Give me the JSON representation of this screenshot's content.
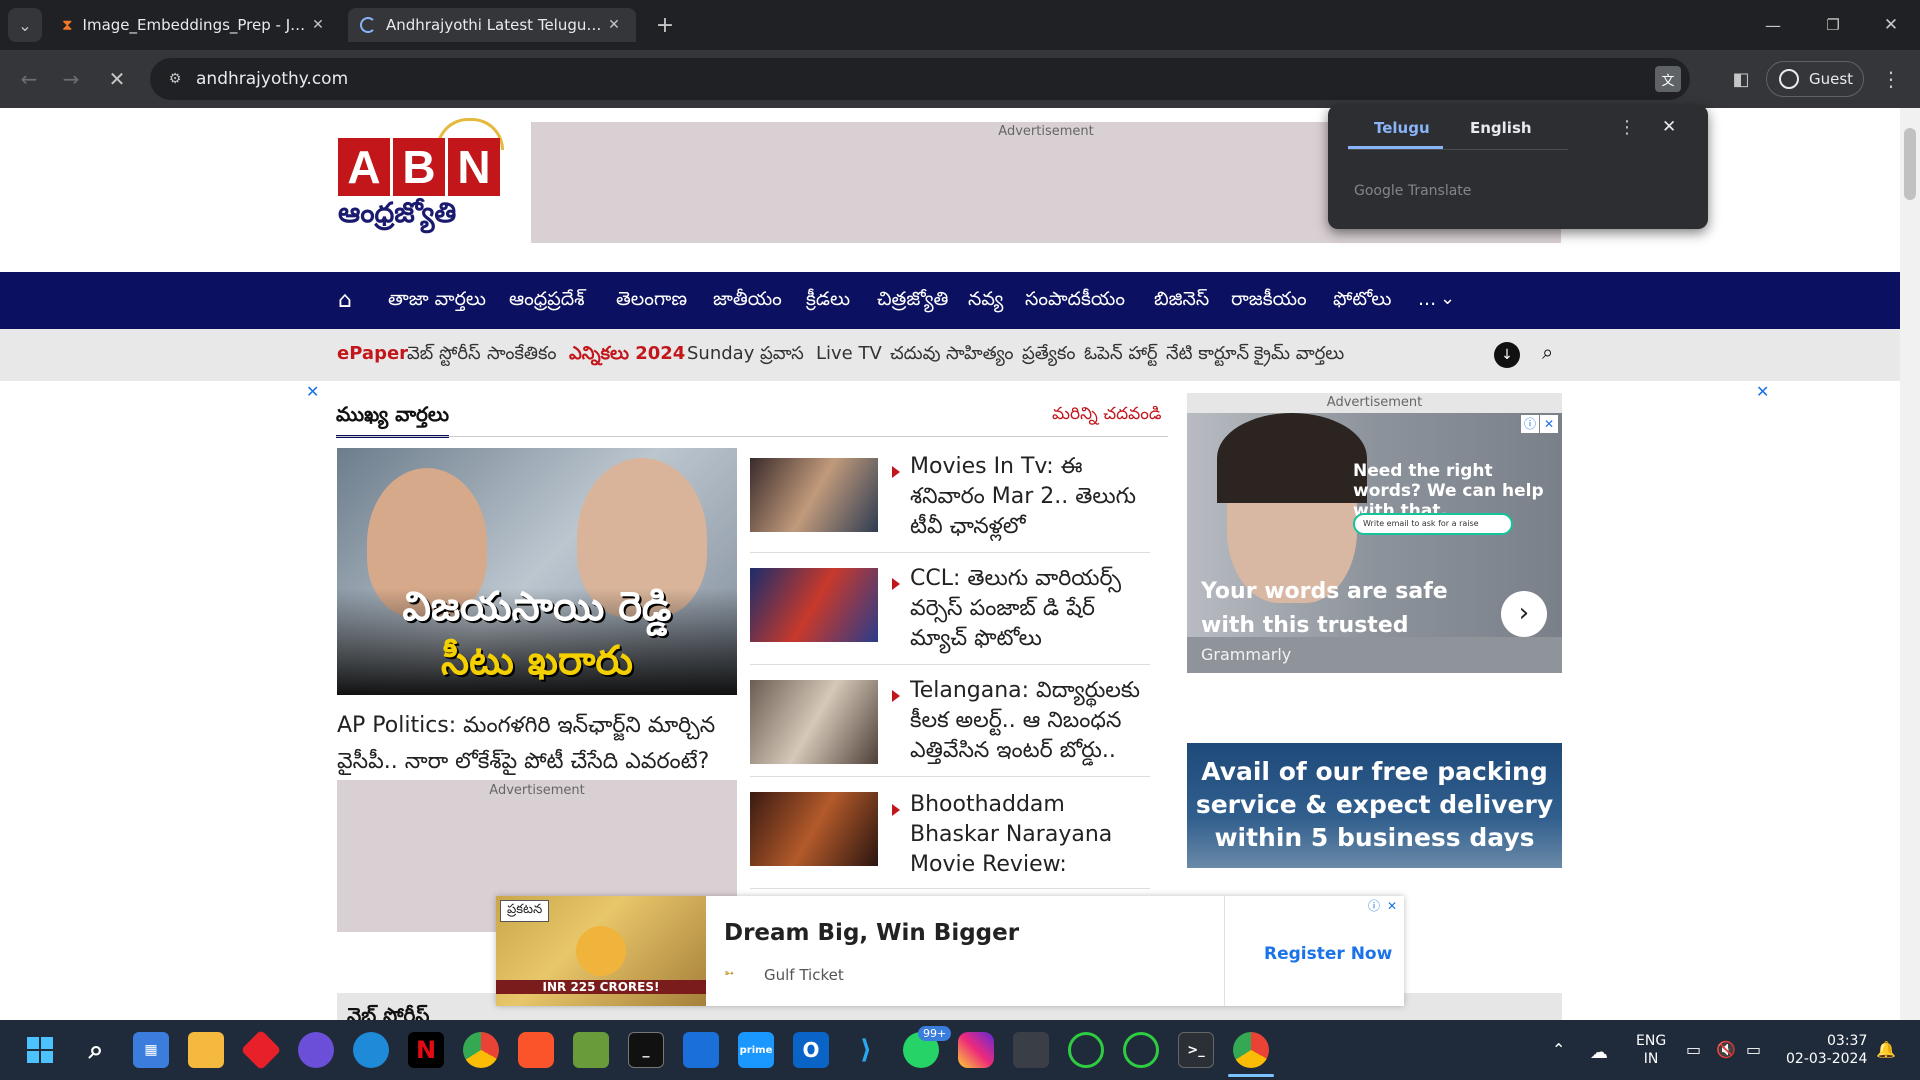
{
  "browser": {
    "tabs": [
      {
        "title": "Image_Embeddings_Prep - Jupyter",
        "icon": "hourglass-icon"
      },
      {
        "title": "Andhrajyothi Latest Telugu News",
        "icon": "loading-icon"
      }
    ],
    "url": "andhrajyothy.com",
    "profile": "Guest"
  },
  "translate": {
    "tab1": "Telugu",
    "tab2": "English",
    "brand": "Google Translate"
  },
  "site": {
    "logo_text": "ABN",
    "logo_sub": "ఆంధ్రజ్యోతి",
    "advert_label": "Advertisement",
    "nav": [
      "తాజా వార్తలు",
      "ఆంధ్రప్రదేశ్",
      "తెలంగాణ",
      "జాతీయం",
      "క్రీడలు",
      "చిత్రజ్యోతి",
      "నవ్య",
      "సంపాదకీయం",
      "బిజినెస్",
      "రాజకీయం",
      "ఫోటోలు",
      "..."
    ],
    "subnav": [
      "ePaper",
      "వెబ్ స్టోరీస్",
      "సాంకేతికం",
      "ఎన్నికలు 2024",
      "Sunday",
      "ప్రవాస",
      "Live TV",
      "చదువు",
      "సాహిత్యం",
      "ప్రత్యేకం",
      "ఓపెన్ హార్ట్",
      "నేటి కార్టూన్",
      "క్రైమ్ వార్తలు"
    ],
    "section_title": "ముఖ్య వార్తలు",
    "more_link": "మరిన్ని చదవండి",
    "lead_image_text1": "విజయసాయి రెడ్డి",
    "lead_image_text2": "సీటు ఖరారు",
    "lead_headline": "AP Politics: మంగళగిరి ఇన్‌ఛార్జ్‌ని మార్చిన వైసీపీ.. నారా లోకేశ్‌పై పోటీ చేసేది ఎవరంటే?",
    "stories": [
      {
        "title": "Movies In Tv: ఈ శనివారం Mar 2.. తెలుగు టీవీ ఛానళ్లలో ప్రసారమయ్యే..."
      },
      {
        "title": "CCL: తెలుగు వారియర్స్ వర్సెస్ పంజాబ్ డి షేర్ మ్యాచ్ ఫొటోలు"
      },
      {
        "title": "Telangana: విద్యార్థులకు కీలక అలర్ట్.. ఆ నిబంధన ఎత్తివేసిన ఇంటర్ బోర్డు.."
      },
      {
        "title": "Bhoothaddam Bhaskar Narayana Movie Review: పరవాలేదు,..."
      }
    ],
    "ad1": {
      "headline": "Need the right words? We can help with that.",
      "input": "Write email to ask for a raise",
      "tagline": "Your words are safe with this trusted writing tool.",
      "brand": "Grammarly"
    },
    "ad2": {
      "text": "Avail of our free packing service & expect delivery within 5 business days"
    },
    "bottom_ad": {
      "badge": "ప్రకటన",
      "promo": "INR 225 CRORES!",
      "headline": "Dream Big, Win Bigger",
      "brand": "Gulf Ticket",
      "cta": "Register Now"
    },
    "next_section": "వెబ్ స్టోరీస్"
  },
  "taskbar": {
    "badge": "99+",
    "lang1": "ENG",
    "lang2": "IN",
    "time": "03:37",
    "date": "02-03-2024"
  }
}
